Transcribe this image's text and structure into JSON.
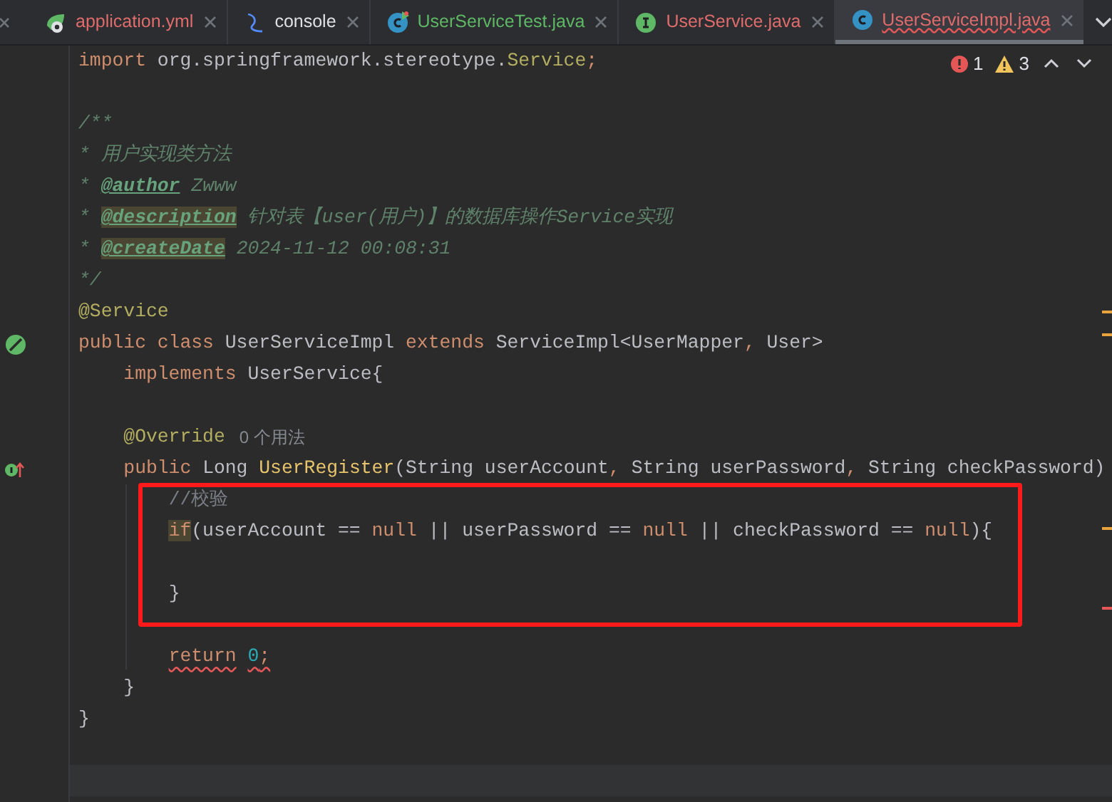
{
  "tabs": [
    {
      "label": "application.yml",
      "kind": "yml",
      "color": "#e06c6c",
      "selected": false
    },
    {
      "label": "console",
      "kind": "console",
      "color": "#dfe1e5",
      "selected": false
    },
    {
      "label": "UserServiceTest.java",
      "kind": "test_class",
      "color": "#5fb865",
      "selected": false
    },
    {
      "label": "UserService.java",
      "kind": "interface",
      "color": "#e06c6c",
      "selected": false
    },
    {
      "label": "UserServiceImpl.java",
      "kind": "class",
      "color": "#e06c6c",
      "selected": true
    }
  ],
  "inspections": [
    {
      "kind": "error",
      "count": "1"
    },
    {
      "kind": "warning",
      "count": "3"
    }
  ],
  "lines": [
    {
      "kind": "code",
      "tokens": [
        {
          "text": "import ",
          "kind": "kw",
          "highlighted": false,
          "error": false
        },
        {
          "text": "org.springframework.stereotype.",
          "kind": "plain",
          "highlighted": false,
          "error": false
        },
        {
          "text": "Service",
          "kind": "ann",
          "highlighted": false,
          "error": false
        },
        {
          "text": ";",
          "kind": "kw",
          "highlighted": false,
          "error": false
        }
      ]
    },
    {
      "kind": "blank"
    },
    {
      "kind": "code",
      "tokens": [
        {
          "text": "/**",
          "kind": "doc",
          "highlighted": false,
          "error": false
        }
      ]
    },
    {
      "kind": "code",
      "tokens": [
        {
          "text": "* 用户实现类方法",
          "kind": "doc",
          "highlighted": false,
          "error": false
        }
      ]
    },
    {
      "kind": "code",
      "tokens": [
        {
          "text": "* ",
          "kind": "doc",
          "highlighted": false,
          "error": false
        },
        {
          "text": "@author",
          "kind": "doctag",
          "highlighted": false,
          "error": false
        },
        {
          "text": " Zwww",
          "kind": "doc",
          "highlighted": false,
          "error": false
        }
      ]
    },
    {
      "kind": "code",
      "tokens": [
        {
          "text": "* ",
          "kind": "doc",
          "highlighted": false,
          "error": false
        },
        {
          "text": "@description",
          "kind": "doctag",
          "highlighted": true,
          "error": false
        },
        {
          "text": " 针对表【user(用户)】的数据库操作Service实现",
          "kind": "doc",
          "highlighted": false,
          "error": false
        }
      ]
    },
    {
      "kind": "code",
      "tokens": [
        {
          "text": "* ",
          "kind": "doc",
          "highlighted": false,
          "error": false
        },
        {
          "text": "@createDate",
          "kind": "doctag",
          "highlighted": true,
          "error": false
        },
        {
          "text": " 2024-11-12 00:08:31",
          "kind": "doc",
          "highlighted": false,
          "error": false
        }
      ]
    },
    {
      "kind": "code",
      "tokens": [
        {
          "text": "*/",
          "kind": "doc",
          "highlighted": false,
          "error": false
        }
      ]
    },
    {
      "kind": "code",
      "tokens": [
        {
          "text": "@Service",
          "kind": "ann",
          "highlighted": false,
          "error": false
        }
      ]
    },
    {
      "kind": "code",
      "gutter": {
        "kind": "bean"
      },
      "tokens": [
        {
          "text": "public class ",
          "kind": "kw",
          "highlighted": false,
          "error": false
        },
        {
          "text": "UserServiceImpl ",
          "kind": "plain",
          "highlighted": false,
          "error": false
        },
        {
          "text": "extends ",
          "kind": "kw",
          "highlighted": false,
          "error": false
        },
        {
          "text": "ServiceImpl<UserMapper",
          "kind": "plain",
          "highlighted": false,
          "error": false
        },
        {
          "text": ", ",
          "kind": "kw",
          "highlighted": false,
          "error": false
        },
        {
          "text": "User>",
          "kind": "plain",
          "highlighted": false,
          "error": false
        }
      ]
    },
    {
      "kind": "code",
      "tokens": [
        {
          "text": "    implements ",
          "kind": "kw",
          "highlighted": false,
          "error": false
        },
        {
          "text": "UserService{",
          "kind": "plain",
          "highlighted": false,
          "error": false
        }
      ]
    },
    {
      "kind": "blank"
    },
    {
      "kind": "code",
      "hint": "0 个用法",
      "tokens": [
        {
          "text": "    @Override",
          "kind": "ann",
          "highlighted": false,
          "error": false
        }
      ]
    },
    {
      "kind": "code",
      "gutter": {
        "kind": "implements"
      },
      "tokens": [
        {
          "text": "    public ",
          "kind": "kw",
          "highlighted": false,
          "error": false
        },
        {
          "text": "Long ",
          "kind": "plain",
          "highlighted": false,
          "error": false
        },
        {
          "text": "UserRegister",
          "kind": "method",
          "highlighted": false,
          "error": false
        },
        {
          "text": "(String userAccount",
          "kind": "plain",
          "highlighted": false,
          "error": false
        },
        {
          "text": ", ",
          "kind": "kw",
          "highlighted": false,
          "error": false
        },
        {
          "text": "String userPassword",
          "kind": "plain",
          "highlighted": false,
          "error": false
        },
        {
          "text": ", ",
          "kind": "kw",
          "highlighted": false,
          "error": false
        },
        {
          "text": "String checkPassword)",
          "kind": "plain",
          "highlighted": false,
          "error": false
        }
      ]
    },
    {
      "kind": "code",
      "tokens": [
        {
          "text": "        //校验",
          "kind": "cmt",
          "highlighted": false,
          "error": false
        }
      ]
    },
    {
      "kind": "code",
      "tokens": [
        {
          "text": "        if",
          "kind": "kw",
          "highlighted": true,
          "error": false
        },
        {
          "text": "(userAccount == ",
          "kind": "plain",
          "highlighted": false,
          "error": false
        },
        {
          "text": "null",
          "kind": "kw",
          "highlighted": false,
          "error": false
        },
        {
          "text": " || userPassword == ",
          "kind": "plain",
          "highlighted": false,
          "error": false
        },
        {
          "text": "null",
          "kind": "kw",
          "highlighted": false,
          "error": false
        },
        {
          "text": " || checkPassword == ",
          "kind": "plain",
          "highlighted": false,
          "error": false
        },
        {
          "text": "null",
          "kind": "kw",
          "highlighted": false,
          "error": false
        },
        {
          "text": "){",
          "kind": "plain",
          "highlighted": false,
          "error": false
        }
      ]
    },
    {
      "kind": "blank"
    },
    {
      "kind": "code",
      "tokens": [
        {
          "text": "        }",
          "kind": "plain",
          "highlighted": false,
          "error": false
        }
      ]
    },
    {
      "kind": "blank"
    },
    {
      "kind": "code",
      "tokens": [
        {
          "text": "        return",
          "kind": "kw",
          "highlighted": false,
          "error": true
        },
        {
          "text": " 0",
          "kind": "num",
          "highlighted": false,
          "error": true
        },
        {
          "text": ";",
          "kind": "kw",
          "highlighted": false,
          "error": true
        }
      ]
    },
    {
      "kind": "code",
      "tokens": [
        {
          "text": "    }",
          "kind": "plain",
          "highlighted": false,
          "error": false
        }
      ]
    },
    {
      "kind": "code",
      "tokens": [
        {
          "text": "}",
          "kind": "plain",
          "highlighted": false,
          "error": false
        }
      ]
    }
  ]
}
